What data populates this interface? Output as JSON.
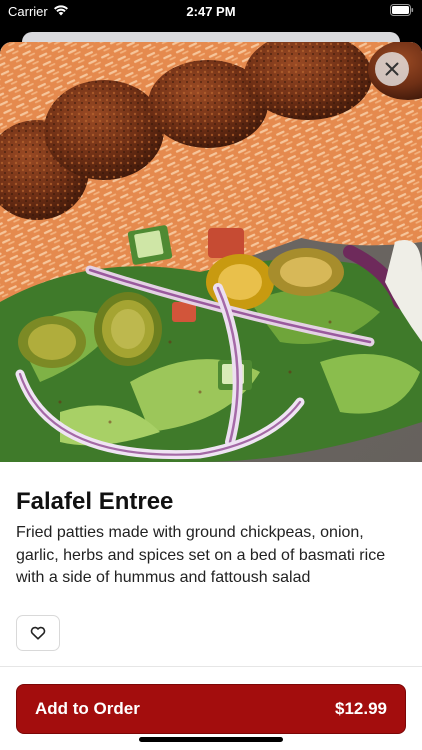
{
  "status_bar": {
    "carrier": "Carrier",
    "time": "2:47 PM",
    "wifi_icon": "wifi-icon",
    "battery_icon": "battery-icon"
  },
  "item": {
    "image": "falafel-entree-photo",
    "name": "Falafel Entree",
    "description": "Fried patties made with ground chickpeas, onion, garlic, herbs and spices set on a bed of basmati rice with a side of hummus and fattoush salad"
  },
  "actions": {
    "close_icon": "close-icon",
    "favorite_icon": "heart-icon",
    "add_label": "Add to Order",
    "price": "$12.99"
  },
  "colors": {
    "accent": "#a30d0d",
    "background": "#ffffff",
    "text": "#111111"
  }
}
